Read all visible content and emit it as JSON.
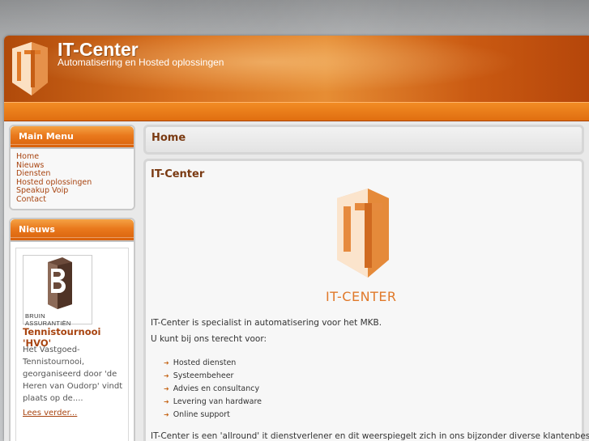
{
  "header": {
    "title": "IT-Center",
    "subtitle": "Automatisering en Hosted oplossingen"
  },
  "sidebar": {
    "main_menu": {
      "title": "Main Menu",
      "items": [
        "Home",
        "Nieuws",
        "Diensten",
        "Hosted oplossingen",
        "Speakup Voip",
        "Contact"
      ]
    },
    "news": {
      "title": "Nieuws",
      "image_caption": "BRUIN ASSURANTIËN",
      "article_title": "Tennistournooi 'HVO'",
      "article_text": "Het Vastgoed-Tennistournooi, georganiseerd door 'de Heren van Oudorp' vindt plaats op de....",
      "read_more": "Lees verder..."
    }
  },
  "main": {
    "page_heading": "Home",
    "section_title": "IT-Center",
    "logo_text": "IT-CENTER",
    "intro": "IT-Center is specialist in automatisering voor het MKB.",
    "lead": "U kunt bij ons terecht voor:",
    "features": [
      "Hosted diensten",
      "Systeembeheer",
      "Advies en consultancy",
      "Levering van hardware",
      "Online support"
    ],
    "closing": "IT-Center is een 'allround' it dienstverlener en dit weerspiegelt zich in ons bijzonder diverse klantenbestand"
  },
  "colors": {
    "accent_orange": "#e9781c",
    "link_brown": "#a84410",
    "heading_brown": "#7a3a12"
  }
}
